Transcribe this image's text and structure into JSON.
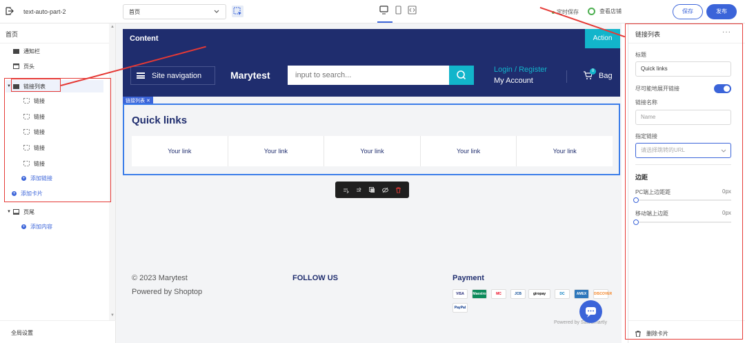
{
  "topbar": {
    "project_name": "text-auto-part-2",
    "page_select_value": "首页",
    "autosave_label": "定时保存",
    "view_shop_label": "查看店铺",
    "save_label": "保存",
    "publish_label": "发布"
  },
  "left_panel": {
    "title": "首页",
    "items": [
      {
        "label": "通知栏"
      },
      {
        "label": "页头"
      },
      {
        "label": "链接列表"
      },
      {
        "label": "链接"
      },
      {
        "label": "链接"
      },
      {
        "label": "链接"
      },
      {
        "label": "链接"
      },
      {
        "label": "链接"
      }
    ],
    "add_link_label": "添加链接",
    "add_card_label": "添加卡片",
    "footer_label": "页尾",
    "add_content_label": "添加内容",
    "global_settings_label": "全局设置"
  },
  "canvas": {
    "content_title": "Content",
    "action_label": "Action",
    "site_nav_label": "Site navigation",
    "brand": "Marytest",
    "search_placeholder": "input to search...",
    "login_label": "Login / Register",
    "account_label": "My Account",
    "cart_count": "0",
    "bag_label": "Bag",
    "section_tag": "链接列表 ✕",
    "quick_links_title": "Quick links",
    "links": [
      "Your link",
      "Your link",
      "Your link",
      "Your link",
      "Your link"
    ],
    "copyright": "© 2023 Marytest",
    "powered": "Powered by Shoptop",
    "follow_us": "FOLLOW US",
    "payment": "Payment",
    "payment_methods": [
      "VISA",
      "Maestro",
      "MC",
      "JCB",
      "giropay",
      "DC",
      "AMEX",
      "DISCOVER",
      "PayPal"
    ],
    "safesmartly": "Powered by SafeSmartly"
  },
  "right_panel": {
    "title": "链接列表",
    "more": "···",
    "label_title": "标题",
    "title_value": "Quick links",
    "open_new_label": "尽可能地展开链接",
    "link_name_label": "链接名称",
    "link_name_placeholder": "Name",
    "target_link_label": "指定链接",
    "target_link_placeholder": "请选择跳转的URL",
    "margin_section": "边距",
    "pc_margin_label": "PC端上边距距",
    "pc_margin_value": "0px",
    "mobile_margin_label": "移动端上边距",
    "mobile_margin_value": "0px",
    "delete_card_label": "删除卡片"
  },
  "colors": {
    "accent": "#3b64d9",
    "header_navy": "#1f2d6e",
    "teal": "#12b5cb",
    "annotation_red": "#e53935"
  }
}
